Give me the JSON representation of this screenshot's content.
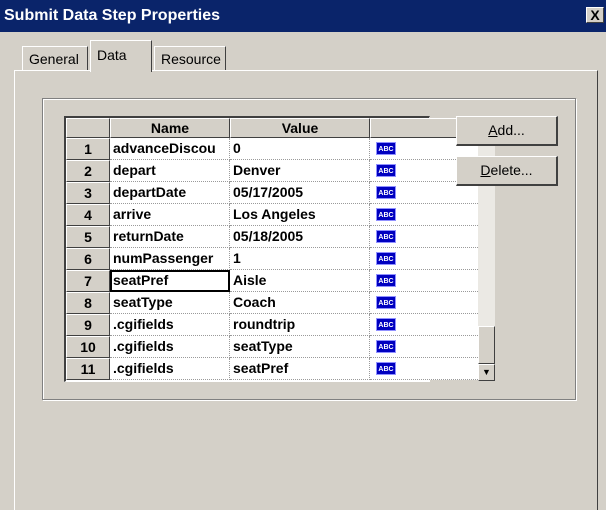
{
  "window": {
    "title": "Submit Data Step Properties",
    "close_label": "X"
  },
  "tabs": [
    {
      "label": "General",
      "selected": false
    },
    {
      "label": "Data",
      "selected": true
    },
    {
      "label": "Resource",
      "selected": false
    }
  ],
  "grid": {
    "columns": [
      "Name",
      "Value"
    ],
    "type_icon": "abc-icon",
    "type_icon_text": "ABC",
    "selected_row": 7,
    "rows": [
      {
        "num": "1",
        "name": "advanceDiscou",
        "value": "0"
      },
      {
        "num": "2",
        "name": "depart",
        "value": "Denver"
      },
      {
        "num": "3",
        "name": "departDate",
        "value": "05/17/2005"
      },
      {
        "num": "4",
        "name": "arrive",
        "value": "Los Angeles"
      },
      {
        "num": "5",
        "name": "returnDate",
        "value": "05/18/2005"
      },
      {
        "num": "6",
        "name": "numPassenger",
        "value": "1"
      },
      {
        "num": "7",
        "name": "seatPref",
        "value": "Aisle"
      },
      {
        "num": "8",
        "name": "seatType",
        "value": "Coach"
      },
      {
        "num": "9",
        "name": ".cgifields",
        "value": "roundtrip"
      },
      {
        "num": "10",
        "name": ".cgifields",
        "value": "seatType"
      },
      {
        "num": "11",
        "name": ".cgifields",
        "value": "seatPref"
      }
    ]
  },
  "buttons": {
    "add_mnemonic": "A",
    "add_rest": "dd...",
    "delete_mnemonic": "D",
    "delete_rest": "elete..."
  }
}
